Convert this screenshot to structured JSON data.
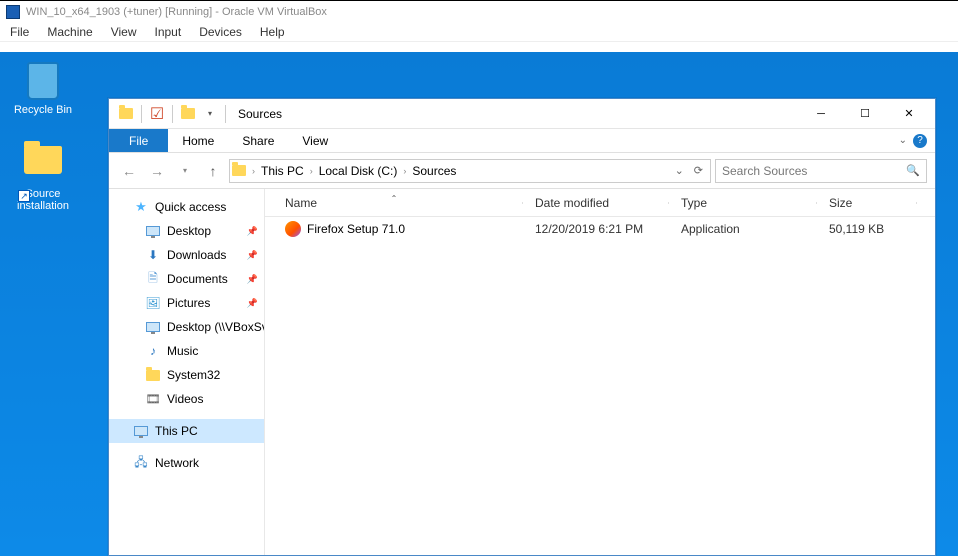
{
  "vbox": {
    "title": "WIN_10_x64_1903 (+tuner) [Running] - Oracle VM VirtualBox",
    "menu": [
      "File",
      "Machine",
      "View",
      "Input",
      "Devices",
      "Help"
    ]
  },
  "desktop": {
    "icons": [
      {
        "label": "Recycle Bin",
        "kind": "recyclebin"
      },
      {
        "label": "Source installation",
        "kind": "folder-shortcut"
      }
    ]
  },
  "explorer": {
    "title": "Sources",
    "ribbon": {
      "file": "File",
      "tabs": [
        "Home",
        "Share",
        "View"
      ]
    },
    "breadcrumb": [
      "This PC",
      "Local Disk (C:)",
      "Sources"
    ],
    "search_placeholder": "Search Sources",
    "sidebar": {
      "quick_access": "Quick access",
      "items": [
        {
          "label": "Desktop",
          "icon": "monitor",
          "pinned": true
        },
        {
          "label": "Downloads",
          "icon": "download",
          "pinned": true
        },
        {
          "label": "Documents",
          "icon": "document",
          "pinned": true
        },
        {
          "label": "Pictures",
          "icon": "pictures",
          "pinned": true
        },
        {
          "label": "Desktop (\\\\VBoxSvr",
          "icon": "monitor",
          "pinned": false
        },
        {
          "label": "Music",
          "icon": "music",
          "pinned": false
        },
        {
          "label": "System32",
          "icon": "folder",
          "pinned": false
        },
        {
          "label": "Videos",
          "icon": "video",
          "pinned": false
        }
      ],
      "this_pc": "This PC",
      "network": "Network"
    },
    "columns": {
      "name": "Name",
      "date": "Date modified",
      "type": "Type",
      "size": "Size"
    },
    "files": [
      {
        "name": "Firefox Setup 71.0",
        "date": "12/20/2019 6:21 PM",
        "type": "Application",
        "size": "50,119 KB"
      }
    ]
  }
}
